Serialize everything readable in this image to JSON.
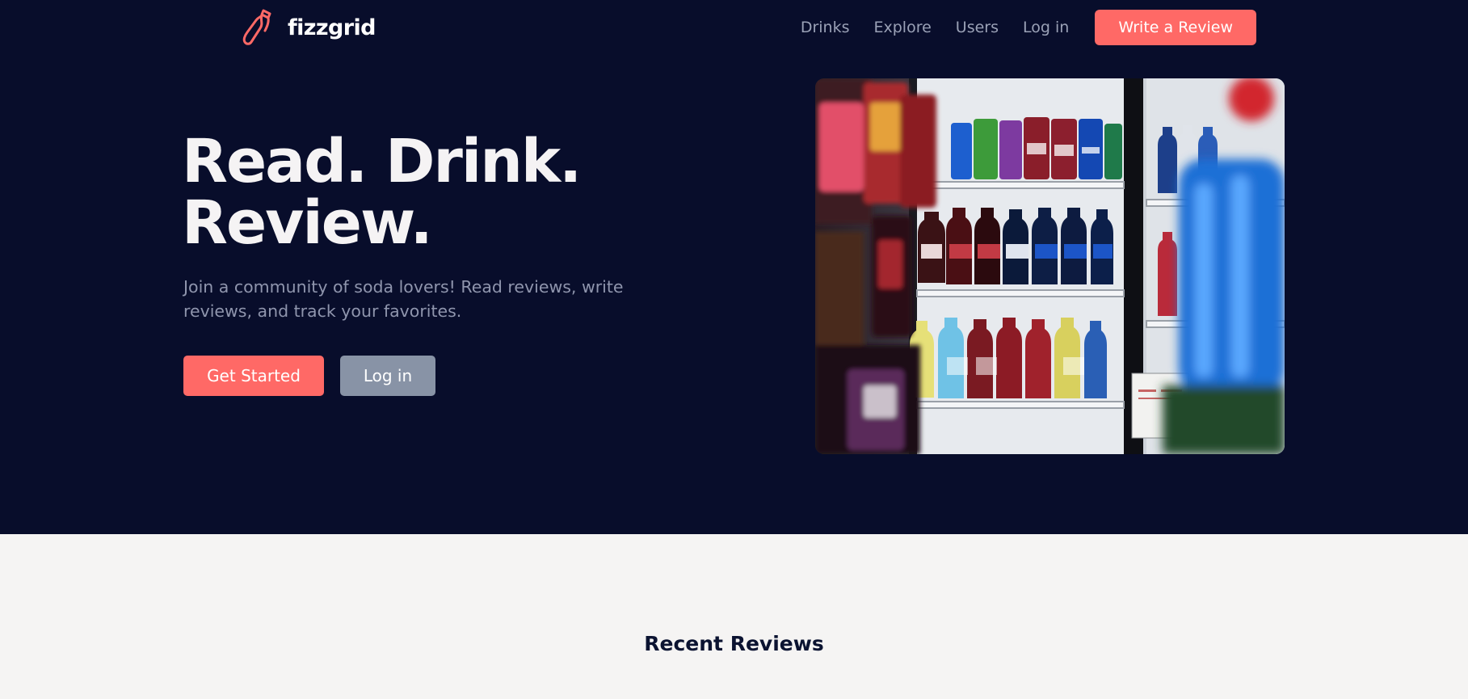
{
  "brand": {
    "name": "fizzgrid",
    "accent_color": "#ff6966",
    "logo_icon": "bottle-icon"
  },
  "nav": {
    "links": [
      "Drinks",
      "Explore",
      "Users",
      "Log in"
    ],
    "cta_label": "Write a Review"
  },
  "hero": {
    "title_line1": "Read. Drink.",
    "title_line2": "Review.",
    "subtitle": "Join a community of soda lovers! Read reviews, write reviews, and track your favorites.",
    "primary_button": "Get Started",
    "secondary_button": "Log in",
    "background_color": "#080d2b"
  },
  "recent_reviews": {
    "heading": "Recent Reviews"
  },
  "colors": {
    "page_background": "#f5f4f3",
    "secondary_button": "#8893a6",
    "muted_text": "#8f95ad"
  }
}
